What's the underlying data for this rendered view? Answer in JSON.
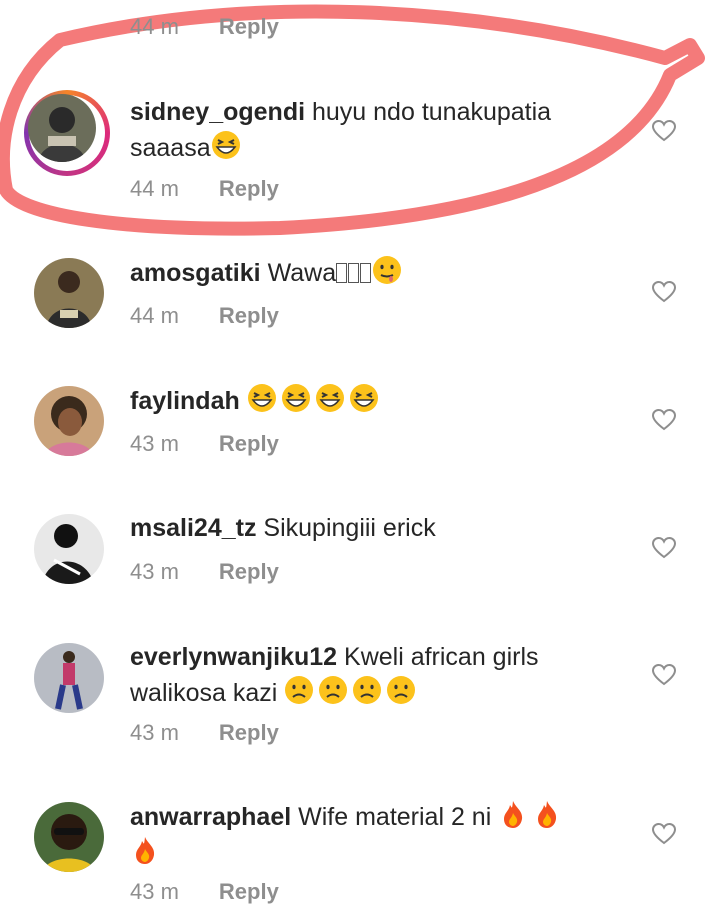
{
  "top_partial": {
    "time": "44 m",
    "reply_label": "Reply"
  },
  "comments": [
    {
      "username": "sidney_ogendi",
      "text_line1": "huyu ndo tunakupatia",
      "text_line2": "saaasa",
      "time": "44 m",
      "reply_label": "Reply",
      "highlighted": true,
      "story_ring": true,
      "emojis": [
        "grinning-squint-emoji"
      ]
    },
    {
      "username": "amosgatiki",
      "text_line1": "Wawa",
      "time": "44 m",
      "reply_label": "Reply",
      "emojis": [
        "unsupported-glyph",
        "unsupported-glyph",
        "unsupported-glyph",
        "drooling-face-emoji"
      ]
    },
    {
      "username": "faylindah",
      "text_line1": "",
      "time": "43 m",
      "reply_label": "Reply",
      "emojis": [
        "grinning-squint-emoji",
        "grinning-squint-emoji",
        "grinning-squint-emoji",
        "grinning-squint-emoji"
      ]
    },
    {
      "username": "msali24_tz",
      "text_line1": "Sikupingiii erick",
      "time": "43 m",
      "reply_label": "Reply"
    },
    {
      "username": "everlynwanjiku12",
      "text_line1": "Kweli african girls",
      "text_line2": "walikosa kazi",
      "time": "43 m",
      "reply_label": "Reply",
      "emojis": [
        "sad-face-emoji",
        "sad-face-emoji",
        "sad-face-emoji",
        "sad-face-emoji"
      ]
    },
    {
      "username": "anwarraphael",
      "text_line1": "Wife material 2 ni",
      "time": "43 m",
      "reply_label": "Reply",
      "emojis": [
        "fire-emoji",
        "fire-emoji",
        "fire-emoji"
      ]
    }
  ],
  "colors": {
    "text": "#262626",
    "meta": "#8e8e8e",
    "highlight_stroke": "#f47a7a",
    "heart_stroke": "#8e8e8e"
  }
}
